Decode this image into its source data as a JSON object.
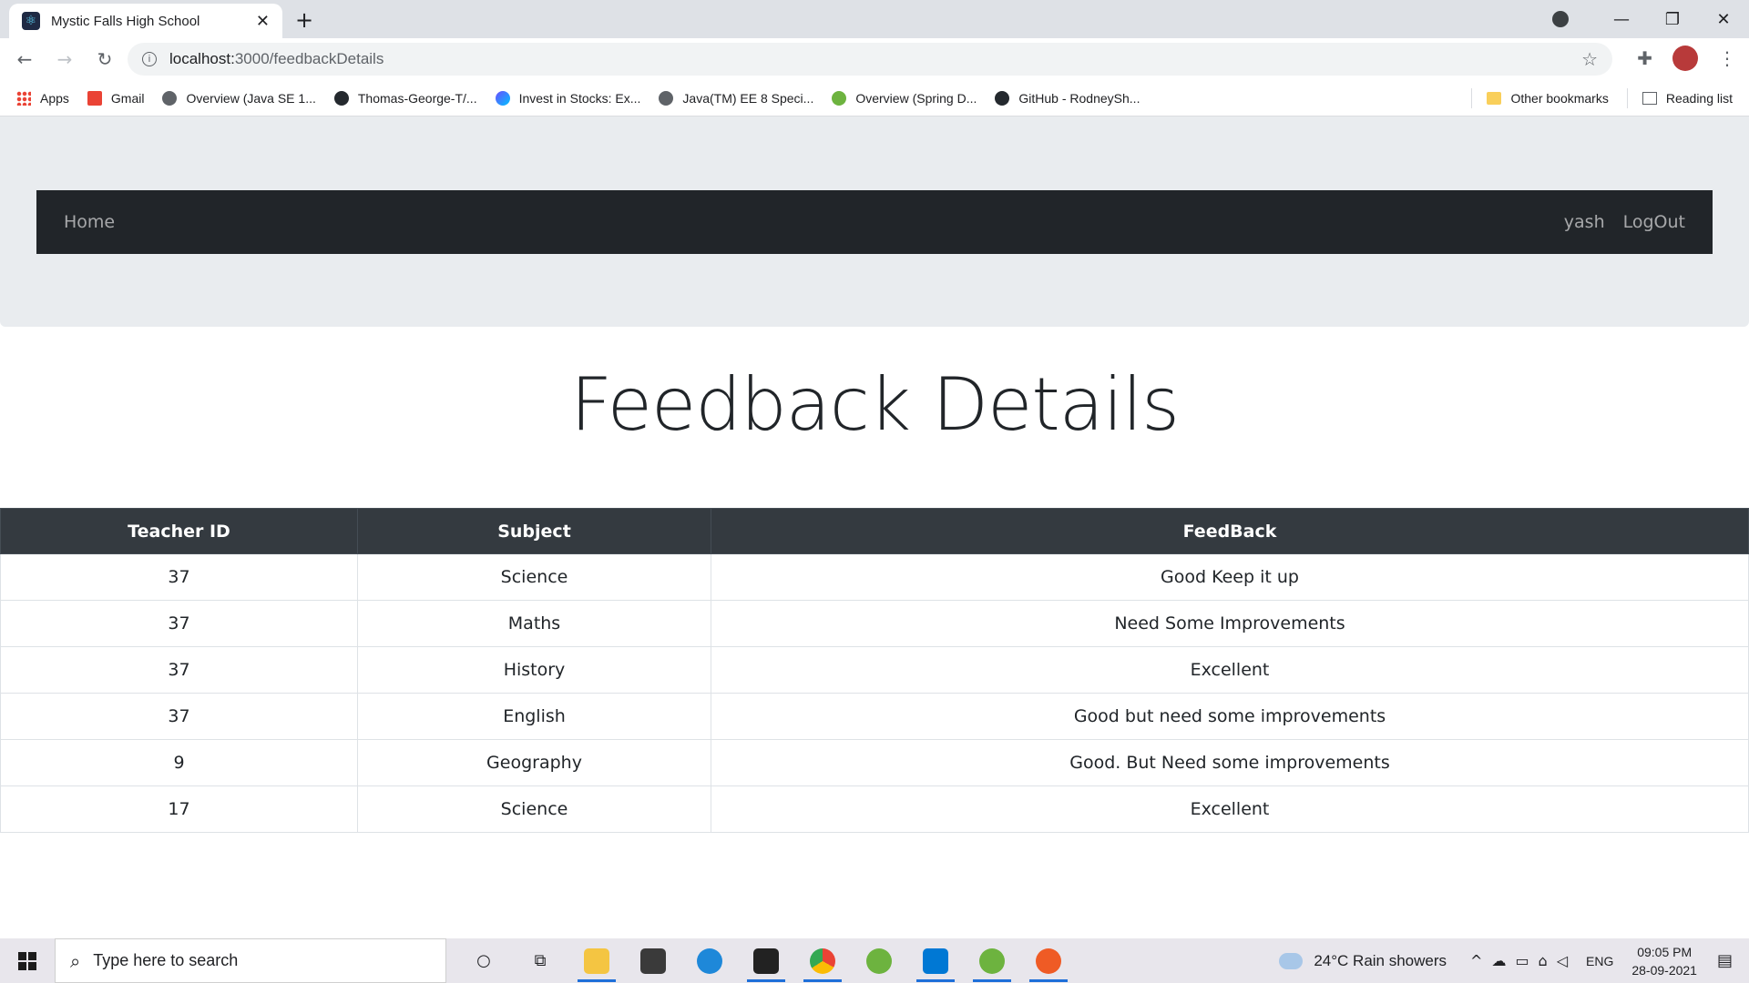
{
  "browser": {
    "tab_title": "Mystic Falls High School",
    "url_host": "localhost:",
    "url_path": "3000/feedbackDetails",
    "bookmarks": [
      {
        "label": "Apps",
        "icon": "apps-grid-icon"
      },
      {
        "label": "Gmail",
        "icon": "gmail-icon"
      },
      {
        "label": "Overview (Java SE 1...",
        "icon": "globe-icon"
      },
      {
        "label": "Thomas-George-T/...",
        "icon": "github-icon"
      },
      {
        "label": "Invest in Stocks: Ex...",
        "icon": "invest-icon"
      },
      {
        "label": "Java(TM) EE 8 Speci...",
        "icon": "globe-icon"
      },
      {
        "label": "Overview (Spring D...",
        "icon": "spring-icon"
      },
      {
        "label": "GitHub - RodneySh...",
        "icon": "github-icon"
      }
    ],
    "other_bookmarks": "Other bookmarks",
    "reading_list": "Reading list"
  },
  "navbar": {
    "home": "Home",
    "user": "yash",
    "logout": "LogOut"
  },
  "page": {
    "heading": "Feedback Details"
  },
  "table": {
    "headers": [
      "Teacher ID",
      "Subject",
      "FeedBack"
    ],
    "rows": [
      [
        "37",
        "Science",
        "Good Keep it up"
      ],
      [
        "37",
        "Maths",
        "Need Some Improvements"
      ],
      [
        "37",
        "History",
        "Excellent"
      ],
      [
        "37",
        "English",
        "Good but need some improvements"
      ],
      [
        "9",
        "Geography",
        "Good. But Need some improvements"
      ],
      [
        "17",
        "Science",
        "Excellent"
      ]
    ]
  },
  "taskbar": {
    "search_placeholder": "Type here to search",
    "weather": "24°C  Rain showers",
    "lang": "ENG",
    "time": "09:05 PM",
    "date": "28-09-2021"
  }
}
